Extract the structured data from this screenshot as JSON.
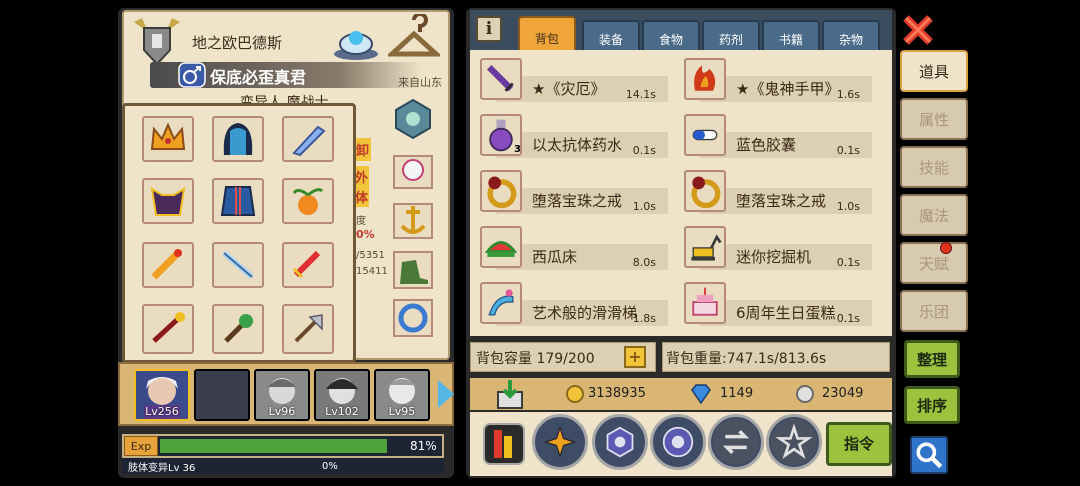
{
  "character": {
    "name": "地之欧巴德斯",
    "title": "保底必歪真君",
    "origin": "来自山东",
    "subname": "变异人 魔战士",
    "side_fragments": [
      "卸",
      "外",
      "体",
      "度",
      "0%",
      "/5351",
      "15411"
    ]
  },
  "equipment_popup": {
    "slots": [
      "crown",
      "dark-cloak",
      "wing-blade",
      "demon-armor",
      "blue-coat",
      "pumpkin-sprout",
      "firework-sword",
      "ice-blade",
      "red-sword",
      "red-staff",
      "green-mace",
      "silver-axe"
    ]
  },
  "team": {
    "members": [
      {
        "level": "Lv256"
      },
      {
        "level": ""
      },
      {
        "level": "Lv96"
      },
      {
        "level": "Lv102"
      },
      {
        "level": "Lv95"
      }
    ]
  },
  "exp": {
    "tag": "Exp",
    "percent_label": "81%",
    "fraction": 0.81,
    "skill_label": "肢体变异Lv 36",
    "skill_percent": "0%"
  },
  "inventory": {
    "tabs": [
      "背包",
      "装备",
      "食物",
      "药剂",
      "书籍",
      "杂物"
    ],
    "active_tab": "背包",
    "info_label": "i",
    "items": [
      {
        "name": "★《灾厄》",
        "weight": "14.1s",
        "qty": "",
        "icon": "purple-sword-icon"
      },
      {
        "name": "★《鬼神手甲》",
        "weight": "1.6s",
        "qty": "",
        "icon": "flame-gauntlet-icon"
      },
      {
        "name": "以太抗体药水",
        "weight": "0.1s",
        "qty": "3",
        "icon": "potion-icon"
      },
      {
        "name": "蓝色胶囊",
        "weight": "0.1s",
        "qty": "",
        "icon": "capsule-icon"
      },
      {
        "name": "堕落宝珠之戒",
        "weight": "1.0s",
        "qty": "",
        "icon": "ring-icon"
      },
      {
        "name": "堕落宝珠之戒",
        "weight": "1.0s",
        "qty": "",
        "icon": "ring-icon"
      },
      {
        "name": "西瓜床",
        "weight": "8.0s",
        "qty": "",
        "icon": "watermelon-bed-icon"
      },
      {
        "name": "迷你挖掘机",
        "weight": "0.1s",
        "qty": "",
        "icon": "excavator-icon"
      },
      {
        "name": "艺术般的滑滑梯",
        "weight": "1.8s",
        "qty": "",
        "icon": "slide-icon"
      },
      {
        "name": "6周年生日蛋糕",
        "weight": "0.1s",
        "qty": "",
        "icon": "cake-icon"
      }
    ],
    "capacity_label": "背包容量 179/200",
    "capacity_plus": "+",
    "weight_label": "背包重量:747.1s/813.6s"
  },
  "currency": {
    "gold": "3138935",
    "diamond": "1149",
    "silver": "23049"
  },
  "bottom": {
    "command_label": "指令"
  },
  "side_tabs": [
    "道具",
    "属性",
    "技能",
    "魔法",
    "天赋",
    "乐团"
  ],
  "active_side_tab": "道具",
  "side_buttons": [
    "整理",
    "排序"
  ],
  "colors": {
    "parchment": "#efe4c9",
    "active_tab": "#f0a53a",
    "tab_blue": "#4a6a8a",
    "green_button": "#9bc33d",
    "exp_green": "#4fa33a"
  }
}
